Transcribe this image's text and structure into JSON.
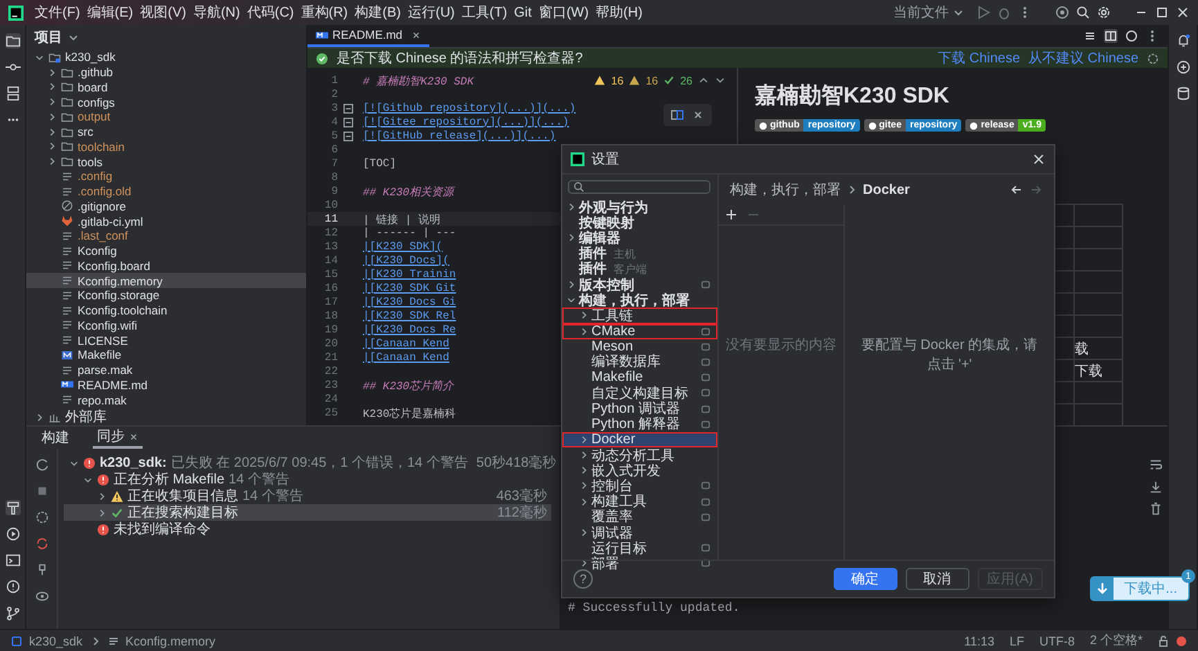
{
  "title_bar": {
    "menu": [
      "文件(F)",
      "编辑(E)",
      "视图(V)",
      "导航(N)",
      "代码(C)",
      "重构(R)",
      "构建(B)",
      "运行(U)",
      "工具(T)",
      "Git",
      "窗口(W)",
      "帮助(H)"
    ],
    "run_config": "当前文件"
  },
  "project_panel": {
    "title": "项目",
    "root": {
      "name": "k230_sdk",
      "expanded": true,
      "children": [
        {
          "name": ".github",
          "kind": "folder",
          "expanded": false,
          "ignored": false,
          "selected": false
        },
        {
          "name": "board",
          "kind": "folder",
          "expanded": false,
          "ignored": false,
          "selected": false
        },
        {
          "name": "configs",
          "kind": "folder",
          "expanded": false,
          "ignored": false,
          "selected": false
        },
        {
          "name": "output",
          "kind": "folder",
          "expanded": false,
          "ignored": true,
          "selected": false
        },
        {
          "name": "src",
          "kind": "folder",
          "expanded": false,
          "ignored": false,
          "selected": false
        },
        {
          "name": "toolchain",
          "kind": "folder",
          "expanded": false,
          "ignored": true,
          "selected": false
        },
        {
          "name": "tools",
          "kind": "folder",
          "expanded": false,
          "ignored": false,
          "selected": false
        },
        {
          "name": ".config",
          "kind": "text",
          "ignored": true,
          "selected": false
        },
        {
          "name": ".config.old",
          "kind": "text",
          "ignored": true,
          "selected": false
        },
        {
          "name": ".gitignore",
          "kind": "gitignore",
          "ignored": false,
          "selected": false
        },
        {
          "name": ".gitlab-ci.yml",
          "kind": "gitlab",
          "ignored": false,
          "selected": false
        },
        {
          "name": ".last_conf",
          "kind": "text",
          "ignored": true,
          "selected": false
        },
        {
          "name": "Kconfig",
          "kind": "text",
          "ignored": false,
          "selected": false
        },
        {
          "name": "Kconfig.board",
          "kind": "text",
          "ignored": false,
          "selected": false
        },
        {
          "name": "Kconfig.memory",
          "kind": "text",
          "ignored": false,
          "selected": true
        },
        {
          "name": "Kconfig.storage",
          "kind": "text",
          "ignored": false,
          "selected": false
        },
        {
          "name": "Kconfig.toolchain",
          "kind": "text",
          "ignored": false,
          "selected": false
        },
        {
          "name": "Kconfig.wifi",
          "kind": "text",
          "ignored": false,
          "selected": false
        },
        {
          "name": "LICENSE",
          "kind": "text",
          "ignored": false,
          "selected": false
        },
        {
          "name": "Makefile",
          "kind": "makefile",
          "ignored": false,
          "selected": false
        },
        {
          "name": "parse.mak",
          "kind": "text",
          "ignored": false,
          "selected": false
        },
        {
          "name": "README.md",
          "kind": "markdown",
          "ignored": false,
          "selected": false
        },
        {
          "name": "repo.mak",
          "kind": "text",
          "ignored": false,
          "selected": false
        }
      ]
    },
    "external": {
      "name": "外部库",
      "expanded": false
    }
  },
  "editor": {
    "tab": "README.md",
    "notification": {
      "text": "是否下载 Chinese 的语法和拼写检查器?",
      "actions": [
        "下载 Chinese",
        "从不建议 Chinese"
      ]
    },
    "inspections": {
      "warnings": "16",
      "weak_warnings": "16",
      "ok": "26"
    },
    "lines": [
      {
        "number": "1",
        "kind": "heading",
        "text": "# 嘉楠勘智K230 SDK",
        "fold": false,
        "current": false
      },
      {
        "number": "2",
        "fold": false,
        "current": false
      },
      {
        "number": "3",
        "kind": "link",
        "text": "[![Github repository](...)](...)",
        "fold": true,
        "current": false
      },
      {
        "number": "4",
        "kind": "link",
        "text": "[![Gitee repository](...)](...)",
        "fold": true,
        "current": false
      },
      {
        "number": "5",
        "kind": "link",
        "text": "[![GitHub release](...)](...)",
        "fold": true,
        "current": false
      },
      {
        "number": "6",
        "fold": false,
        "current": false
      },
      {
        "number": "7",
        "kind": "text",
        "text": "[TOC]",
        "fold": false,
        "current": false
      },
      {
        "number": "8",
        "fold": false,
        "current": false
      },
      {
        "number": "9",
        "kind": "heading",
        "text": "## K230相关资源",
        "fold": false,
        "current": false
      },
      {
        "number": "10",
        "fold": false,
        "current": false
      },
      {
        "number": "11",
        "kind": "table",
        "text": "| 链接 | 说明",
        "fold": false,
        "current": true
      },
      {
        "number": "12",
        "kind": "table",
        "text": "| ------ | ---",
        "fold": false,
        "current": false
      },
      {
        "number": "13",
        "kind": "link",
        "text": "|[K230 SDK](",
        "fold": false,
        "current": false
      },
      {
        "number": "14",
        "kind": "link",
        "text": "|[K230 Docs](",
        "fold": false,
        "current": false
      },
      {
        "number": "15",
        "kind": "link",
        "text": "|[K230 Trainin",
        "fold": false,
        "current": false
      },
      {
        "number": "16",
        "kind": "link",
        "text": "|[K230 SDK Git",
        "fold": false,
        "current": false
      },
      {
        "number": "17",
        "kind": "link",
        "text": "|[K230 Docs Gi",
        "fold": false,
        "current": false
      },
      {
        "number": "18",
        "kind": "link",
        "text": "|[K230 SDK Rel",
        "fold": false,
        "current": false
      },
      {
        "number": "19",
        "kind": "link",
        "text": "|[K230 Docs Re",
        "fold": false,
        "current": false
      },
      {
        "number": "20",
        "kind": "link",
        "text": "|[Canaan Kend",
        "fold": false,
        "current": false
      },
      {
        "number": "21",
        "kind": "link",
        "text": "|[Canaan Kend",
        "fold": false,
        "current": false
      },
      {
        "number": "22",
        "fold": false,
        "current": false
      },
      {
        "number": "23",
        "kind": "heading",
        "text": "## K230芯片简介",
        "fold": false,
        "current": false
      },
      {
        "number": "24",
        "fold": false,
        "current": false
      },
      {
        "number": "25",
        "kind": "text",
        "text": "K230芯片是嘉楠科",
        "fold": false,
        "current": false
      }
    ]
  },
  "preview": {
    "title": "嘉楠勘智K230 SDK",
    "badges": [
      {
        "label": "github",
        "value": "repository",
        "color": "#1f7fc1"
      },
      {
        "label": "gitee",
        "value": "repository",
        "color": "#1f7fc1"
      },
      {
        "label": "release",
        "value": "v1.9",
        "color": "#4caf1f"
      }
    ],
    "table_fragments": [
      "载",
      "下载"
    ]
  },
  "build_panel": {
    "tabs": [
      {
        "label": "构建",
        "selected": false,
        "closable": false
      },
      {
        "label": "同步",
        "selected": true,
        "closable": true
      }
    ],
    "tree": [
      {
        "kind": "error",
        "name": "k230_sdk:",
        "detail": "已失败 在 2025/6/7 09:45，1 个错误，14 个警告",
        "time": "50秒418毫秒",
        "expanded": true,
        "selected": false,
        "children": [
          {
            "kind": "error",
            "name": "正在分析 Makefile",
            "detail": "14 个警告",
            "expanded": true,
            "selected": false,
            "children": [
              {
                "kind": "warning",
                "name": "正在收集项目信息",
                "detail": "14 个警告",
                "time": "463毫秒",
                "expanded": false,
                "selected": false
              },
              {
                "kind": "ok",
                "name": "正在搜索构建目标",
                "time": "112毫秒",
                "expanded": false,
                "selected": true
              }
            ]
          },
          {
            "kind": "error",
            "name": "未找到编译命令",
            "selected": false
          }
        ]
      }
    ]
  },
  "console": {
    "lines": [
      "# Successfully updated."
    ]
  },
  "dialog": {
    "title": "设置",
    "nav": [
      {
        "label": "外观与行为",
        "expanded": false,
        "selected": false,
        "highlighted": false,
        "project_level": false
      },
      {
        "label": "按键映射",
        "selected": false,
        "highlighted": false,
        "project_level": false
      },
      {
        "label": "编辑器",
        "expanded": false,
        "selected": false,
        "highlighted": false,
        "project_level": false
      },
      {
        "label": "插件",
        "note": "主机",
        "selected": false,
        "highlighted": false,
        "project_level": false
      },
      {
        "label": "插件",
        "note": "客户端",
        "selected": false,
        "highlighted": false,
        "project_level": false
      },
      {
        "label": "版本控制",
        "expanded": false,
        "selected": false,
        "highlighted": false,
        "project_level": true
      },
      {
        "label": "构建，执行，部署",
        "expanded": true,
        "selected": false,
        "highlighted": false,
        "project_level": false,
        "children": [
          {
            "label": "工具链",
            "expanded": false,
            "selected": false,
            "highlighted": true,
            "project_level": false
          },
          {
            "label": "CMake",
            "expanded": false,
            "selected": false,
            "highlighted": true,
            "project_level": true
          },
          {
            "label": "Meson",
            "selected": false,
            "highlighted": false,
            "project_level": true
          },
          {
            "label": "编译数据库",
            "selected": false,
            "highlighted": false,
            "project_level": true
          },
          {
            "label": "Makefile",
            "selected": false,
            "highlighted": false,
            "project_level": true
          },
          {
            "label": "自定义构建目标",
            "selected": false,
            "highlighted": false,
            "project_level": true
          },
          {
            "label": "Python 调试器",
            "selected": false,
            "highlighted": false,
            "project_level": true
          },
          {
            "label": "Python 解释器",
            "selected": false,
            "highlighted": false,
            "project_level": true
          },
          {
            "label": "Docker",
            "expanded": false,
            "selected": true,
            "highlighted": true,
            "project_level": false
          },
          {
            "label": "动态分析工具",
            "expanded": false,
            "selected": false,
            "highlighted": false,
            "project_level": false
          },
          {
            "label": "嵌入式开发",
            "expanded": false,
            "selected": false,
            "highlighted": false,
            "project_level": false
          },
          {
            "label": "控制台",
            "expanded": false,
            "selected": false,
            "highlighted": false,
            "project_level": true
          },
          {
            "label": "构建工具",
            "expanded": false,
            "selected": false,
            "highlighted": false,
            "project_level": true
          },
          {
            "label": "覆盖率",
            "selected": false,
            "highlighted": false,
            "project_level": true
          },
          {
            "label": "调试器",
            "expanded": false,
            "selected": false,
            "highlighted": false,
            "project_level": false
          },
          {
            "label": "运行目标",
            "selected": false,
            "highlighted": false,
            "project_level": true
          },
          {
            "label": "部署",
            "expanded": false,
            "selected": false,
            "highlighted": false,
            "project_level": true
          }
        ]
      }
    ],
    "breadcrumb": [
      "构建，执行，部署",
      "Docker"
    ],
    "empty_list": "没有要显示的内容",
    "hint": "要配置与 Docker 的集成，请点击 '+'",
    "help": "?",
    "buttons": [
      {
        "label": "确定",
        "kind": "primary",
        "disabled": false
      },
      {
        "label": "取消",
        "kind": "normal",
        "disabled": false
      },
      {
        "label": "应用(A)",
        "kind": "normal",
        "disabled": true
      }
    ]
  },
  "download_toast": {
    "label": "下载中...",
    "badge": "1"
  },
  "status_bar": {
    "path": [
      "k230_sdk",
      "Kconfig.memory"
    ],
    "items": [
      "11:13",
      "LF",
      "UTF-8",
      "2 个空格*"
    ]
  }
}
